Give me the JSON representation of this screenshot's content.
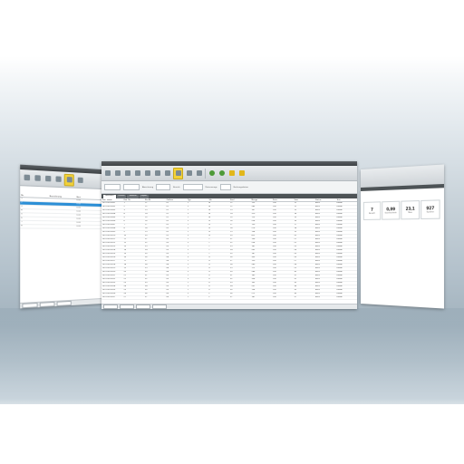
{
  "main": {
    "ribbon_buttons": [
      "arrow",
      "disk",
      "grid",
      "people",
      "chart",
      "cart",
      "chart2",
      "active",
      "doc",
      "doc2",
      "sep",
      "green",
      "green2",
      "yellow",
      "yellow2"
    ],
    "filter_labels": [
      "Abrechnung",
      "Bereich",
      "Datenmenge",
      "Buchungsdatum"
    ],
    "tabs": [
      "Übersicht",
      "Details",
      "Statistik",
      "Export"
    ],
    "columns": [
      "Kon. name",
      "Kon. Nr.",
      "Kto.Nr.",
      "Zeitbez.",
      "Typ.",
      "Stk.",
      "Kauf",
      "Menge",
      "Preis",
      "Sum.",
      "Status",
      "Text"
    ],
    "rows": [
      [
        "D0710010001",
        "1",
        "11",
        "01",
        "1",
        "A",
        "12",
        "123",
        "100",
        "12",
        "aktiv",
        "Kunde"
      ],
      [
        "D0710010002",
        "2",
        "12",
        "01",
        "2",
        "A",
        "12",
        "245",
        "100",
        "12",
        "aktiv",
        "Kunde"
      ],
      [
        "D0710010003",
        "3",
        "13",
        "01",
        "1",
        "A",
        "13",
        "167",
        "100",
        "13",
        "aktiv",
        "Kunde"
      ],
      [
        "D0710010004",
        "4",
        "14",
        "01",
        "3",
        "A",
        "14",
        "310",
        "100",
        "14",
        "aktiv",
        "Kunde"
      ],
      [
        "D0710010005",
        "5",
        "15",
        "01",
        "1",
        "A",
        "15",
        "115",
        "100",
        "15",
        "aktiv",
        "Kunde"
      ],
      [
        "D0710010006",
        "6",
        "16",
        "02",
        "2",
        "B",
        "16",
        "228",
        "100",
        "16",
        "aktiv",
        "Kunde"
      ],
      [
        "D0710010007",
        "7",
        "17",
        "02",
        "1",
        "B",
        "17",
        "190",
        "100",
        "17",
        "aktiv",
        "Kunde"
      ],
      [
        "D0710010008",
        "8",
        "18",
        "02",
        "2",
        "B",
        "18",
        "276",
        "100",
        "18",
        "aktiv",
        "Kunde"
      ],
      [
        "D0710010009",
        "9",
        "19",
        "02",
        "1",
        "B",
        "19",
        "134",
        "100",
        "19",
        "aktiv",
        "Kunde"
      ],
      [
        "D0710010010",
        "10",
        "20",
        "02",
        "3",
        "B",
        "20",
        "412",
        "100",
        "20",
        "aktiv",
        "Kunde"
      ],
      [
        "D0710010011",
        "11",
        "21",
        "03",
        "1",
        "C",
        "21",
        "156",
        "100",
        "21",
        "aktiv",
        "Kunde"
      ],
      [
        "D0710010012",
        "12",
        "22",
        "03",
        "2",
        "C",
        "22",
        "298",
        "100",
        "22",
        "aktiv",
        "Kunde"
      ],
      [
        "D0710010013",
        "13",
        "23",
        "03",
        "1",
        "C",
        "23",
        "141",
        "100",
        "23",
        "aktiv",
        "Kunde"
      ],
      [
        "D0710010014",
        "14",
        "24",
        "03",
        "2",
        "C",
        "24",
        "263",
        "100",
        "24",
        "aktiv",
        "Kunde"
      ],
      [
        "D0710010015",
        "15",
        "25",
        "03",
        "1",
        "C",
        "25",
        "187",
        "100",
        "25",
        "aktiv",
        "Kunde"
      ],
      [
        "D0710010016",
        "16",
        "26",
        "04",
        "3",
        "D",
        "26",
        "355",
        "100",
        "26",
        "aktiv",
        "Kunde"
      ],
      [
        "D0710010017",
        "17",
        "27",
        "04",
        "1",
        "D",
        "27",
        "120",
        "100",
        "27",
        "aktiv",
        "Kunde"
      ],
      [
        "D0710010018",
        "18",
        "28",
        "04",
        "2",
        "D",
        "28",
        "240",
        "100",
        "28",
        "aktiv",
        "Kunde"
      ],
      [
        "D0710010019",
        "19",
        "29",
        "04",
        "1",
        "D",
        "29",
        "172",
        "100",
        "29",
        "aktiv",
        "Kunde"
      ],
      [
        "D0710010020",
        "20",
        "30",
        "04",
        "2",
        "D",
        "30",
        "286",
        "100",
        "30",
        "aktiv",
        "Kunde"
      ],
      [
        "D0710010021",
        "21",
        "31",
        "05",
        "1",
        "E",
        "31",
        "149",
        "100",
        "31",
        "aktiv",
        "Kunde"
      ],
      [
        "D0710010022",
        "22",
        "32",
        "05",
        "3",
        "E",
        "32",
        "398",
        "100",
        "32",
        "aktiv",
        "Kunde"
      ],
      [
        "D0710010023",
        "23",
        "33",
        "05",
        "1",
        "E",
        "33",
        "163",
        "100",
        "33",
        "aktiv",
        "Kunde"
      ],
      [
        "D0710010024",
        "24",
        "34",
        "05",
        "2",
        "E",
        "34",
        "251",
        "100",
        "34",
        "aktiv",
        "Kunde"
      ],
      [
        "D0710010025",
        "25",
        "35",
        "05",
        "1",
        "E",
        "35",
        "138",
        "100",
        "35",
        "aktiv",
        "Kunde"
      ],
      [
        "D0710010026",
        "26",
        "36",
        "06",
        "2",
        "F",
        "36",
        "272",
        "100",
        "36",
        "aktiv",
        "Kunde"
      ],
      [
        "D0710010027",
        "27",
        "37",
        "06",
        "1",
        "F",
        "37",
        "181",
        "100",
        "37",
        "aktiv",
        "Kunde"
      ]
    ],
    "status_buttons": [
      "",
      "",
      "",
      ""
    ]
  },
  "left": {
    "columns": [
      "Nr.",
      "Bezeichnung",
      "Wert"
    ],
    "rows": [
      [
        "1",
        "",
        "0,00"
      ],
      [
        "2",
        "",
        "0,00"
      ],
      [
        "3",
        "",
        "0,00"
      ],
      [
        "4",
        "",
        "0,00"
      ],
      [
        "5",
        "",
        "0,00"
      ],
      [
        "6",
        "",
        "0,00"
      ],
      [
        "7",
        "",
        "0,00"
      ],
      [
        "8",
        "",
        "0,00"
      ]
    ],
    "selected_row": 1
  },
  "right": {
    "cards": [
      {
        "num": "7",
        "lbl": "Anzahl"
      },
      {
        "num": "0,99",
        "lbl": "Durchschnitt"
      },
      {
        "num": "23,1",
        "lbl": "Max"
      },
      {
        "num": "927",
        "lbl": "Summe"
      }
    ]
  },
  "colors": {
    "accent": "#f3d23a",
    "selection": "#2c8fd6",
    "titlebar": "#4d5356"
  }
}
